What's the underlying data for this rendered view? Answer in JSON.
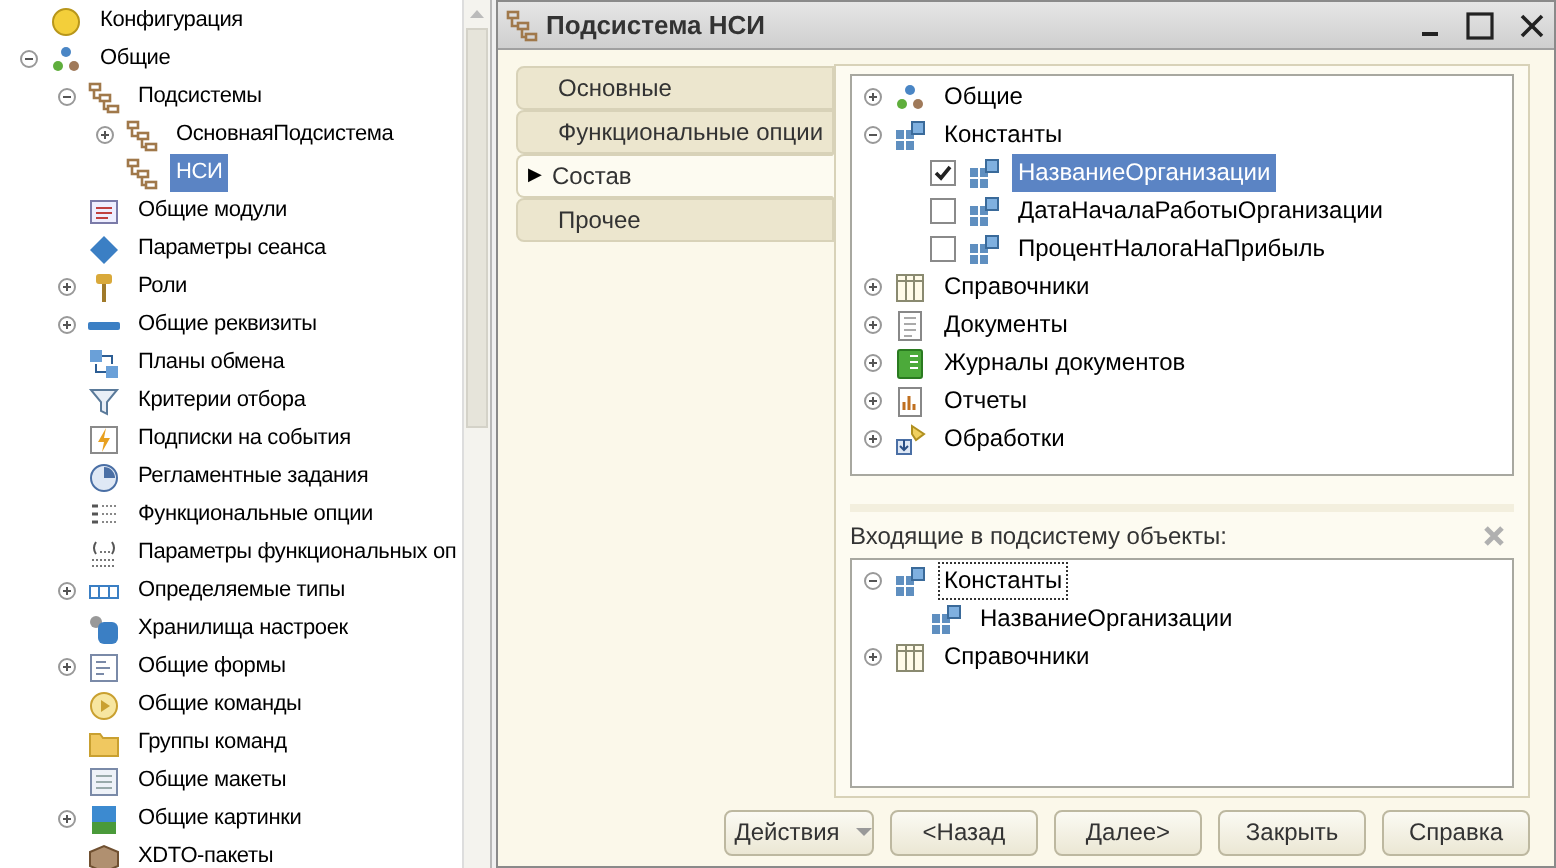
{
  "config_tree": {
    "items": [
      {
        "label": "Конфигурация",
        "children": [
          {
            "label": "Общие",
            "expanded": true,
            "children": [
              {
                "label": "Подсистемы",
                "expanded": true,
                "children": [
                  {
                    "label": "ОсновнаяПодсистема",
                    "expanded": false,
                    "selected": false
                  },
                  {
                    "label": "НСИ",
                    "selected": true
                  }
                ]
              },
              {
                "label": "Общие модули",
                "selected": false
              },
              {
                "label": "Параметры сеанса",
                "selected": false
              },
              {
                "label": "Роли",
                "expanded": false,
                "selected": false
              },
              {
                "label": "Общие реквизиты",
                "expanded": false,
                "selected": false
              },
              {
                "label": "Планы обмена",
                "selected": false
              },
              {
                "label": "Критерии отбора",
                "selected": false
              },
              {
                "label": "Подписки на события",
                "selected": false
              },
              {
                "label": "Регламентные задания",
                "selected": false
              },
              {
                "label": "Функциональные опции",
                "selected": false
              },
              {
                "label": "Параметры функциональных оп",
                "selected": false
              },
              {
                "label": "Определяемые типы",
                "expanded": false,
                "selected": false
              },
              {
                "label": "Хранилища настроек",
                "selected": false
              },
              {
                "label": "Общие формы",
                "expanded": false,
                "selected": false
              },
              {
                "label": "Общие команды",
                "selected": false
              },
              {
                "label": "Группы команд",
                "selected": false
              },
              {
                "label": "Общие макеты",
                "selected": false
              },
              {
                "label": "Общие картинки",
                "expanded": false,
                "selected": false
              },
              {
                "label": "XDTO-пакеты",
                "selected": false
              }
            ]
          }
        ]
      }
    ]
  },
  "window": {
    "title": "Подсистема НСИ"
  },
  "tabs": [
    {
      "label": "Основные",
      "selected": false
    },
    {
      "label": "Функциональные опции",
      "selected": false
    },
    {
      "label": "Состав",
      "selected": true
    },
    {
      "label": "Прочее",
      "selected": false
    }
  ],
  "selected_tab_marker": "▶",
  "objects_tree": {
    "items": [
      {
        "label": "Общие",
        "expanded": false
      },
      {
        "label": "Константы",
        "expanded": true,
        "children": [
          {
            "label": "НазваниеОрганизации",
            "checked": true,
            "selected": true
          },
          {
            "label": "ДатаНачалаРаботыОрганизации",
            "checked": false,
            "selected": false
          },
          {
            "label": "ПроцентНалогаНаПрибыль",
            "checked": false,
            "selected": false
          }
        ]
      },
      {
        "label": "Справочники",
        "expanded": false
      },
      {
        "label": "Документы",
        "expanded": false
      },
      {
        "label": "Журналы документов",
        "expanded": false
      },
      {
        "label": "Отчеты",
        "expanded": false
      },
      {
        "label": "Обработки",
        "expanded": false
      }
    ]
  },
  "included": {
    "label": "Входящие в подсистему объекты:",
    "items": [
      {
        "label": "Константы",
        "expanded": true,
        "focused": true,
        "children": [
          {
            "label": "НазваниеОрганизации",
            "focused": false
          }
        ]
      },
      {
        "label": "Справочники",
        "expanded": false,
        "focused": false
      }
    ]
  },
  "buttons": [
    {
      "label": "Действия",
      "kind": "dropdown"
    },
    {
      "label": "<Назад",
      "kind": "plain"
    },
    {
      "label": "Далее>",
      "kind": "plain"
    },
    {
      "label": "Закрыть",
      "kind": "plain"
    },
    {
      "label": "Справка",
      "kind": "plain"
    }
  ]
}
